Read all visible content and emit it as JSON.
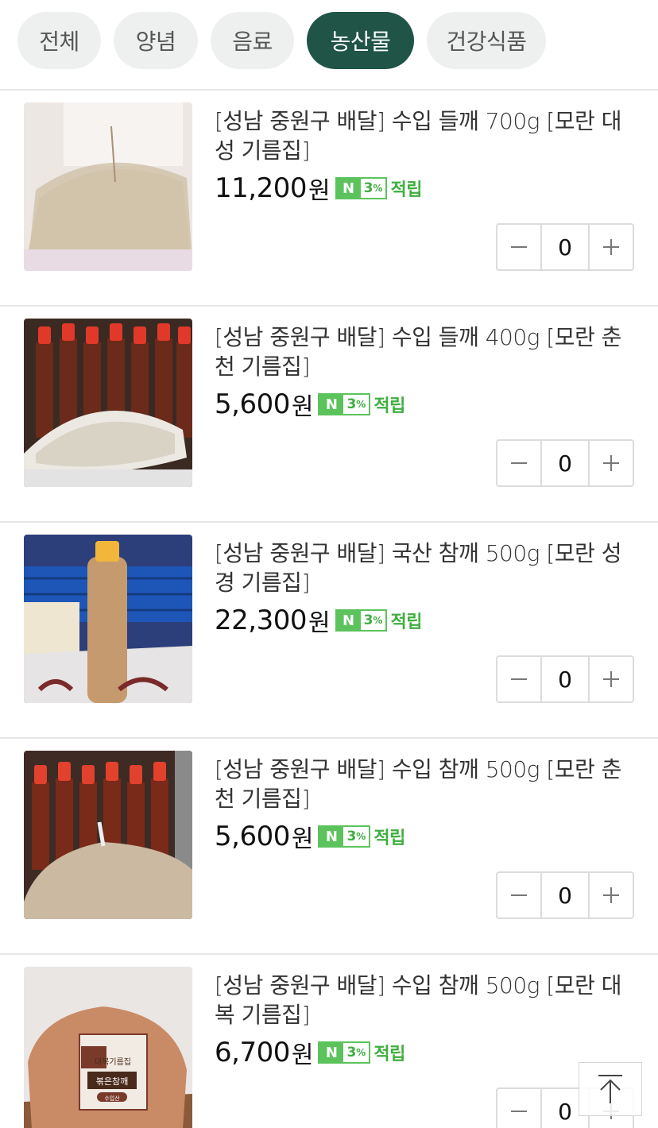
{
  "tabs": [
    {
      "label": "전체",
      "active": false
    },
    {
      "label": "양념",
      "active": false
    },
    {
      "label": "음료",
      "active": false
    },
    {
      "label": "농산물",
      "active": true
    },
    {
      "label": "건강식품",
      "active": false
    }
  ],
  "products": [
    {
      "title": "[성남 중원구 배달] 수입 들깨 700g [모란 대성 기름집]",
      "price": "11,200",
      "currency": "원",
      "npay_rate": "3",
      "npay_unit": "%",
      "reward_label": "적립",
      "qty": "0"
    },
    {
      "title": "[성남 중원구 배달] 수입 들깨 400g [모란 춘천 기름집]",
      "price": "5,600",
      "currency": "원",
      "npay_rate": "3",
      "npay_unit": "%",
      "reward_label": "적립",
      "qty": "0"
    },
    {
      "title": "[성남 중원구 배달] 국산 참깨 500g [모란 성경 기름집]",
      "price": "22,300",
      "currency": "원",
      "npay_rate": "3",
      "npay_unit": "%",
      "reward_label": "적립",
      "qty": "0"
    },
    {
      "title": "[성남 중원구 배달] 수입 참깨 500g [모란 춘천 기름집]",
      "price": "5,600",
      "currency": "원",
      "npay_rate": "3",
      "npay_unit": "%",
      "reward_label": "적립",
      "qty": "0"
    },
    {
      "title": "[성남 중원구 배달] 수입 참깨 500g [모란 대복 기름집]",
      "price": "6,700",
      "currency": "원",
      "npay_rate": "3",
      "npay_unit": "%",
      "reward_label": "적립",
      "qty": "0"
    }
  ],
  "package_label": {
    "shop": "대복기름집",
    "product": "볶은참깨",
    "origin": "수입산"
  },
  "npay_mark": "N",
  "colors": {
    "accent": "#1f5447",
    "npay_green": "#5cc35c"
  }
}
